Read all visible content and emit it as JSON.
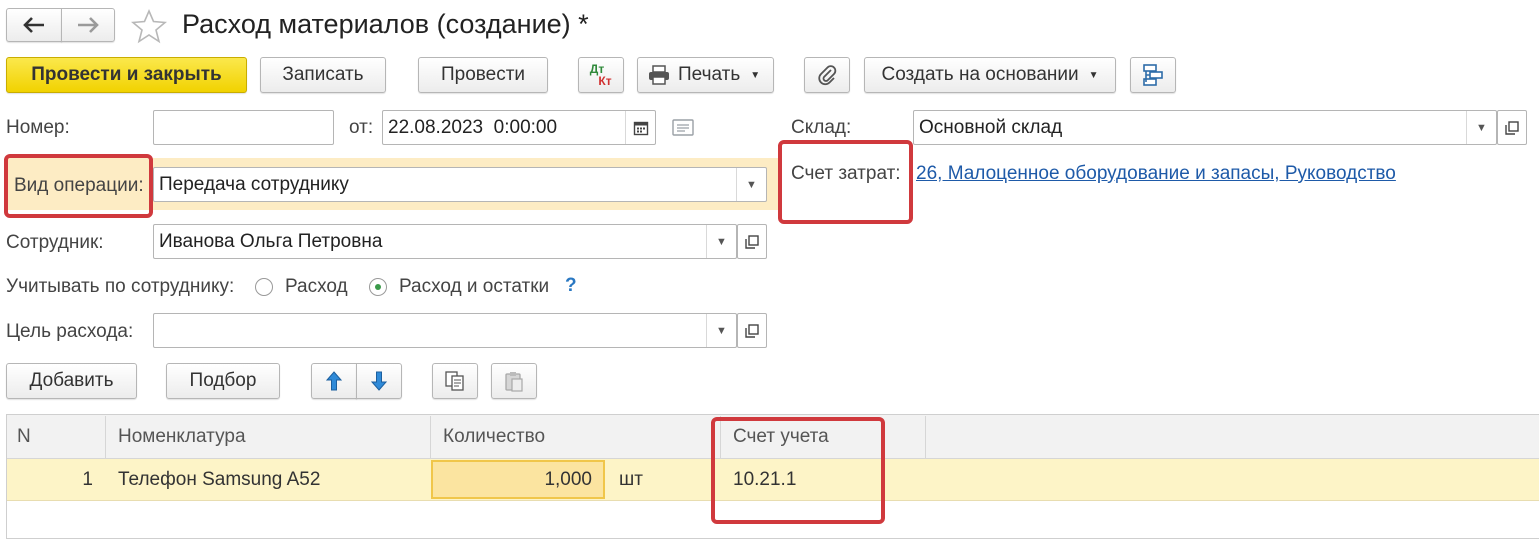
{
  "window": {
    "title": "Расход материалов (создание) *"
  },
  "toolbar": {
    "post_and_close": "Провести и закрыть",
    "save": "Записать",
    "post": "Провести",
    "dt_label": "Дт",
    "kt_label": "Кт",
    "print": "Печать",
    "create_based_on": "Создать на основании"
  },
  "form": {
    "number_label": "Номер:",
    "number_value": "",
    "date_label": "от:",
    "date_value": "22.08.2023  0:00:00",
    "warehouse_label": "Склад:",
    "warehouse_value": "Основной склад",
    "operation_label": "Вид операции:",
    "operation_value": "Передача сотруднику",
    "cost_account_label": "Счет затрат:",
    "cost_account_value": "26, Малоценное оборудование и запасы, Руководство",
    "employee_label": "Сотрудник:",
    "employee_value": "Иванова Ольга Петровна",
    "account_by_label": "Учитывать по сотруднику:",
    "radio_expense": "Расход",
    "radio_expense_balance": "Расход и остатки",
    "radio_selected": "Расход и остатки",
    "help": "?",
    "purpose_label": "Цель расхода:",
    "purpose_value": ""
  },
  "table_toolbar": {
    "add": "Добавить",
    "pick": "Подбор"
  },
  "table": {
    "columns": [
      "N",
      "Номенклатура",
      "Количество",
      "Счет учета"
    ],
    "rows": [
      {
        "n": "1",
        "item": "Телефон Samsung A52",
        "qty": "1,000",
        "unit": "шт",
        "account": "10.21.1"
      }
    ]
  },
  "colors": {
    "primary_button": "#f5d90a",
    "highlight_row": "#fdf4c7",
    "annotation_red": "#d0393d",
    "link": "#1e5aa8"
  }
}
